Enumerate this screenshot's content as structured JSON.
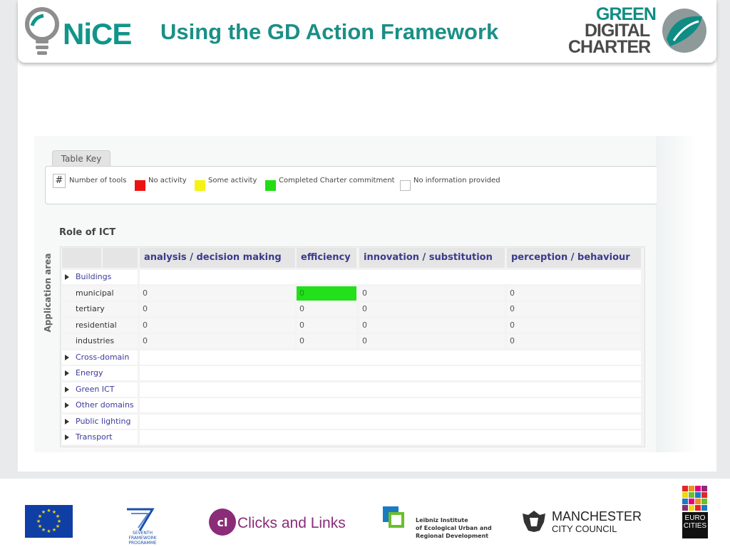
{
  "header": {
    "logo_text": "NiCE",
    "title": "Using the GD Action Framework",
    "right_logo": [
      "GREEN",
      "DIGITAL",
      "CHARTER"
    ]
  },
  "table_key": {
    "tab_label": "Table Key",
    "hash_symbol": "#",
    "items": [
      {
        "label": "Number of tools"
      },
      {
        "label": "No activity",
        "color": "#ee1111"
      },
      {
        "label": "Some activity",
        "color": "#f4f414"
      },
      {
        "label": "Completed Charter commitment",
        "color": "#22dd11"
      },
      {
        "label": "No information provided",
        "color": "#ffffff"
      }
    ]
  },
  "grid": {
    "title": "Role of ICT",
    "row_axis_label": "Application area",
    "columns": [
      "analysis / decision making",
      "efficiency",
      "innovation / substitution",
      "perception / behaviour"
    ],
    "rows": [
      {
        "label": "Buildings",
        "type": "group"
      },
      {
        "label": "municipal",
        "type": "sub",
        "values": [
          "0",
          "0",
          "0",
          "0"
        ],
        "highlight": [
          false,
          true,
          false,
          false
        ]
      },
      {
        "label": "tertiary",
        "type": "sub",
        "values": [
          "0",
          "0",
          "0",
          "0"
        ],
        "highlight": [
          false,
          false,
          false,
          false
        ]
      },
      {
        "label": "residential",
        "type": "sub",
        "values": [
          "0",
          "0",
          "0",
          "0"
        ],
        "highlight": [
          false,
          false,
          false,
          false
        ]
      },
      {
        "label": "industries",
        "type": "sub",
        "values": [
          "0",
          "0",
          "0",
          "0"
        ],
        "highlight": [
          false,
          false,
          false,
          false
        ]
      },
      {
        "label": "Cross-domain",
        "type": "group"
      },
      {
        "label": "Energy",
        "type": "group"
      },
      {
        "label": "Green ICT",
        "type": "group"
      },
      {
        "label": "Other domains",
        "type": "group"
      },
      {
        "label": "Public lighting",
        "type": "group"
      },
      {
        "label": "Transport",
        "type": "group"
      }
    ]
  },
  "footer": {
    "fp7_caption": "SEVENTH FRAMEWORK PROGRAMME",
    "clicks": "Clicks and Links",
    "leibniz": [
      "Leibniz Institute",
      "of Ecological Urban and",
      "Regional Development"
    ],
    "manchester": [
      "MANCHESTER",
      "CITY COUNCIL"
    ],
    "eurocities": [
      "EURO",
      "CITIES"
    ]
  },
  "colors": {
    "brand_teal": "#10958a",
    "header_link": "#3a3a8c",
    "completed_green": "#22e01a"
  }
}
